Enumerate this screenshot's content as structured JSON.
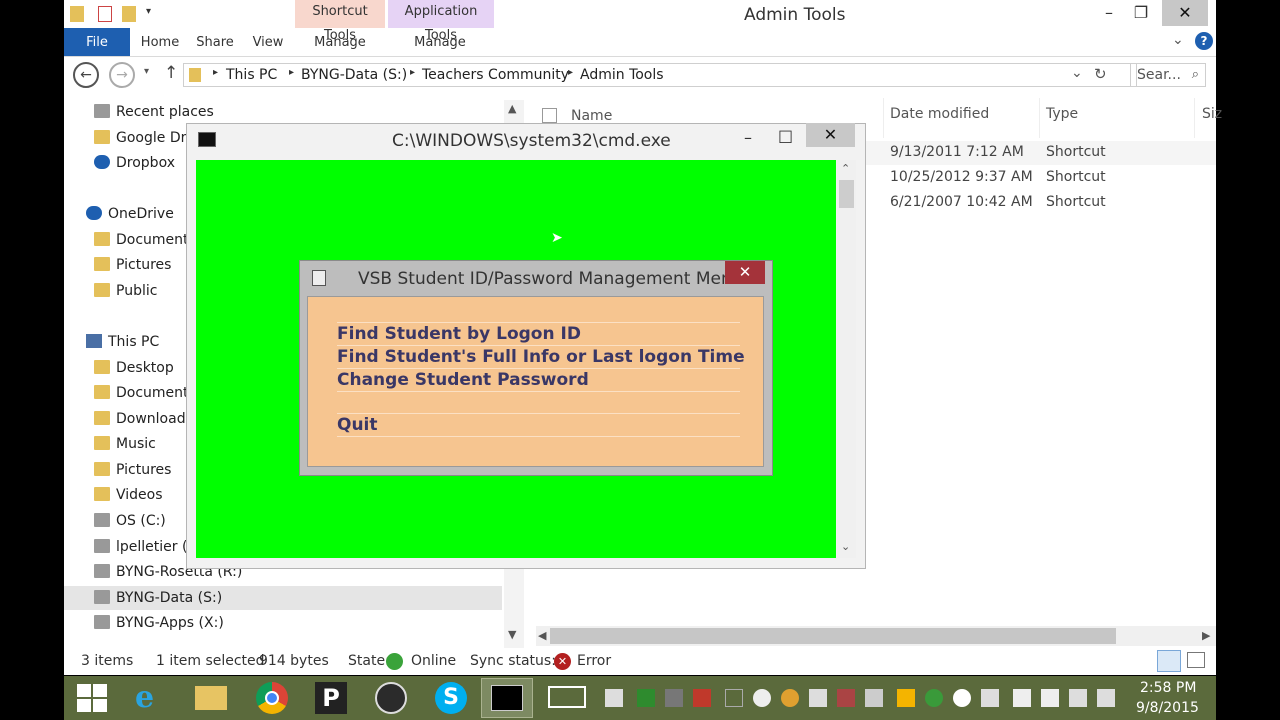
{
  "window": {
    "title": "Admin Tools",
    "context_tabs": [
      "Shortcut Tools",
      "Application Tools"
    ],
    "ribbon": {
      "file": "File",
      "tabs": [
        "Home",
        "Share",
        "View",
        "Manage",
        "Manage"
      ]
    }
  },
  "address": {
    "crumbs": [
      "This PC",
      "BYNG-Data (S:)",
      "Teachers Community",
      "Admin Tools"
    ],
    "search_placeholder": "Sear..."
  },
  "nav": {
    "items": [
      "Recent places",
      "Google Dri",
      "Dropbox",
      "OneDrive",
      "Document",
      "Pictures",
      "Public",
      "This PC",
      "Desktop",
      "Document",
      "Download",
      "Music",
      "Pictures",
      "Videos",
      "OS (C:)",
      "lpelletier (\\",
      "BYNG-Rosetta (R:)",
      "BYNG-Data (S:)",
      "BYNG-Apps (X:)"
    ]
  },
  "content": {
    "columns": [
      "Name",
      "Date modified",
      "Type",
      "Siz"
    ],
    "rows": [
      {
        "date": "9/13/2011 7:12 AM",
        "type": "Shortcut"
      },
      {
        "date": "10/25/2012 9:37 AM",
        "type": "Shortcut"
      },
      {
        "date": "6/21/2007 10:42 AM",
        "type": "Shortcut"
      }
    ]
  },
  "status": {
    "items": "3 items",
    "selected": "1 item selected",
    "size": "914 bytes",
    "state_label": "State:",
    "state_value": "Online",
    "sync_label": "Sync status:",
    "sync_value": "Error"
  },
  "cmd": {
    "title": "C:\\WINDOWS\\system32\\cmd.exe"
  },
  "dialog": {
    "title": "VSB Student ID/Password Management Menu",
    "items": [
      "Find Student by Logon ID",
      "Find Student's Full Info or Last logon Time",
      "Change Student Password",
      "Quit"
    ]
  },
  "taskbar": {
    "time": "2:58 PM",
    "date": "9/8/2015"
  },
  "colors": {
    "cmd_background": "#00ff00",
    "dialog_panel": "#f6c590",
    "dialog_text": "#3a3766",
    "taskbar": "#5b6a3c",
    "file_tab": "#1e5fb0"
  }
}
